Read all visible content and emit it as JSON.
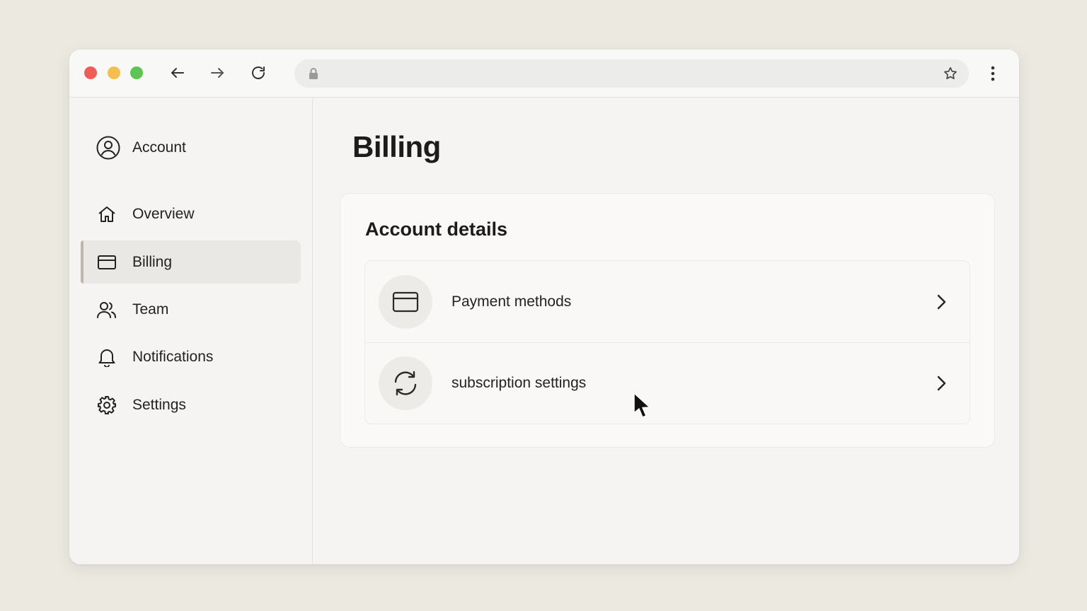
{
  "browser": {
    "url": "",
    "traffic_colors": {
      "close": "#ee5d57",
      "minimize": "#f5bf4f",
      "maximize": "#5fc454"
    },
    "icons": [
      "back-arrow-icon",
      "forward-arrow-icon",
      "reload-icon",
      "lock-icon",
      "star-icon",
      "kebab-menu-icon"
    ]
  },
  "sidebar": {
    "account_label": "Account",
    "items": [
      {
        "label": "Overview",
        "icon": "home-icon",
        "active": false
      },
      {
        "label": "Billing",
        "icon": "credit-card-icon",
        "active": true
      },
      {
        "label": "Team",
        "icon": "users-icon",
        "active": false
      },
      {
        "label": "Notifications",
        "icon": "bell-icon",
        "active": false
      },
      {
        "label": "Settings",
        "icon": "gear-icon",
        "active": false
      }
    ]
  },
  "main": {
    "title": "Billing",
    "card": {
      "title": "Account details",
      "rows": [
        {
          "label": "Payment methods",
          "icon": "credit-card-icon"
        },
        {
          "label": "subscription settings",
          "icon": "refresh-icon"
        }
      ]
    }
  },
  "colors": {
    "background": "#ebe9e0",
    "active_item_bg": "#eae8e4",
    "active_indicator": "#bdb8ae"
  }
}
